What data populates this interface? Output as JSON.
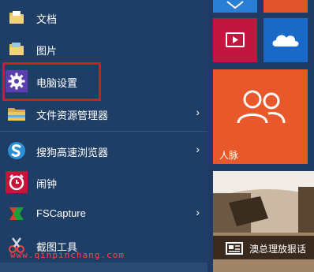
{
  "start_menu": {
    "items": [
      {
        "label": "文档",
        "icon": "documents-folder-icon"
      },
      {
        "label": "图片",
        "icon": "pictures-folder-icon"
      },
      {
        "label": "电脑设置",
        "icon": "gear-icon"
      },
      {
        "label": "文件资源管理器",
        "icon": "file-explorer-icon",
        "has_submenu": true
      },
      {
        "label": "搜狗高速浏览器",
        "icon": "sogou-browser-icon",
        "has_submenu": true
      },
      {
        "label": "闹钟",
        "icon": "alarm-clock-icon"
      },
      {
        "label": "FSCapture",
        "icon": "fscapture-icon",
        "has_submenu": true
      },
      {
        "label": "截图工具",
        "icon": "snipping-tool-icon"
      }
    ],
    "chevron": "›"
  },
  "tiles": {
    "people": {
      "label": "人脉",
      "color": "#e8582a"
    },
    "video": {
      "color": "#c0163f"
    },
    "onedrive": {
      "color": "#1b69c7"
    },
    "news": {
      "label": "澳总理放狠话"
    }
  },
  "watermark": "www.qinpinchang.com",
  "colors": {
    "menu_bg": "#1f3e66",
    "highlight": "#d41a22"
  }
}
